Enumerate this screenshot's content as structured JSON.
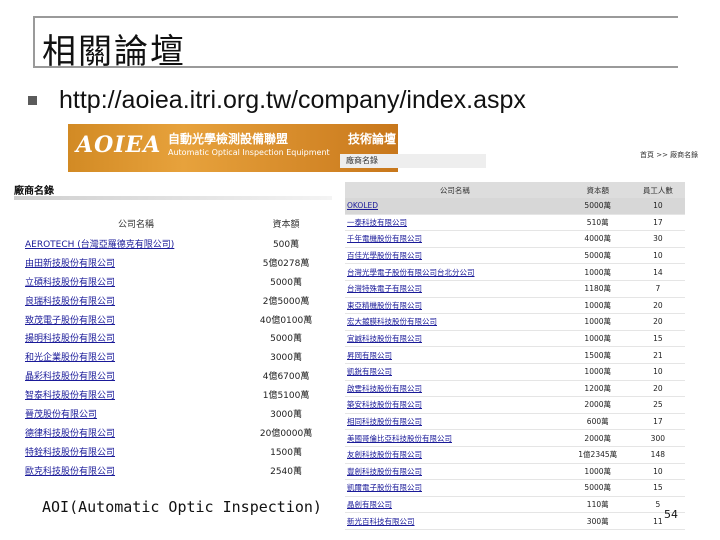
{
  "slide": {
    "title": "相關論壇",
    "url": "http://aoiea.itri.org.tw/company/index.aspx",
    "footer": "AOI(Automatic Optic Inspection)",
    "page_number": "54"
  },
  "banner": {
    "logo": "AOIEA",
    "zh_title": "自動光學檢測設備聯盟",
    "en_title": "Automatic Optical Inspection Equipment",
    "right_label": "技術論壇",
    "nav_label": "廠商名錄",
    "crumb": "首頁 >> 廠商名錄"
  },
  "left_panel": {
    "heading": "廠商名錄",
    "columns": [
      "公司名稱",
      "資本額"
    ],
    "rows": [
      {
        "name": "AEROTECH (台灣亞羅德克有限公司)",
        "capital": "500萬"
      },
      {
        "name": "由田新技股份有限公司",
        "capital": "5億0278萬"
      },
      {
        "name": "立碩科技股份有限公司",
        "capital": "5000萬"
      },
      {
        "name": "良瑞科技股份有限公司",
        "capital": "2億5000萬"
      },
      {
        "name": "致茂電子股份有限公司",
        "capital": "40億0100萬"
      },
      {
        "name": "揚明科技股份有限公司",
        "capital": "5000萬"
      },
      {
        "name": "和光企業股份有限公司",
        "capital": "3000萬"
      },
      {
        "name": "晶彩科技股份有限公司",
        "capital": "4億6700萬"
      },
      {
        "name": "智泰科技股份有限公司",
        "capital": "1億5100萬"
      },
      {
        "name": "晉茂股份有限公司",
        "capital": "3000萬"
      },
      {
        "name": "德律科技股份有限公司",
        "capital": "20億0000萬"
      },
      {
        "name": "特銓科技股份有限公司",
        "capital": "1500萬"
      },
      {
        "name": "歐克科技股份有限公司",
        "capital": "2540萬"
      }
    ]
  },
  "right_panel": {
    "columns": [
      "公司名稱",
      "資本額",
      "員工人數"
    ],
    "rows": [
      {
        "name": "OKOLED",
        "capital": "5000萬",
        "employees": "10"
      },
      {
        "name": "一泰科技有限公司",
        "capital": "510萬",
        "employees": "17"
      },
      {
        "name": "千年電機股份有限公司",
        "capital": "4000萬",
        "employees": "30"
      },
      {
        "name": "百佳光學股份有限公司",
        "capital": "5000萬",
        "employees": "10"
      },
      {
        "name": "台灣光學電子股份有限公司台北分公司",
        "capital": "1000萬",
        "employees": "14"
      },
      {
        "name": "台灣特殊電子有限公司",
        "capital": "1180萬",
        "employees": "7"
      },
      {
        "name": "東亞精機股份有限公司",
        "capital": "1000萬",
        "employees": "20"
      },
      {
        "name": "宏大鍍膜科技股份有限公司",
        "capital": "1000萬",
        "employees": "20"
      },
      {
        "name": "宜誠科技股份有限公司",
        "capital": "1000萬",
        "employees": "15"
      },
      {
        "name": "昇岡有限公司",
        "capital": "1500萬",
        "employees": "21"
      },
      {
        "name": "凱銳有限公司",
        "capital": "1000萬",
        "employees": "10"
      },
      {
        "name": "啟雲科技股份有限公司",
        "capital": "1200萬",
        "employees": "20"
      },
      {
        "name": "築安科技股份有限公司",
        "capital": "2000萬",
        "employees": "25"
      },
      {
        "name": "相同科技股份有限公司",
        "capital": "600萬",
        "employees": "17"
      },
      {
        "name": "美國哥倫比亞科技股份有限公司",
        "capital": "2000萬",
        "employees": "300"
      },
      {
        "name": "友創科技股份有限公司",
        "capital": "1億2345萬",
        "employees": "148"
      },
      {
        "name": "豐創科技股份有限公司",
        "capital": "1000萬",
        "employees": "10"
      },
      {
        "name": "凱爾電子股份有限公司",
        "capital": "5000萬",
        "employees": "15"
      },
      {
        "name": "晶創有限公司",
        "capital": "110萬",
        "employees": "5"
      },
      {
        "name": "新光百科技有限公司",
        "capital": "300萬",
        "employees": "11"
      }
    ]
  }
}
